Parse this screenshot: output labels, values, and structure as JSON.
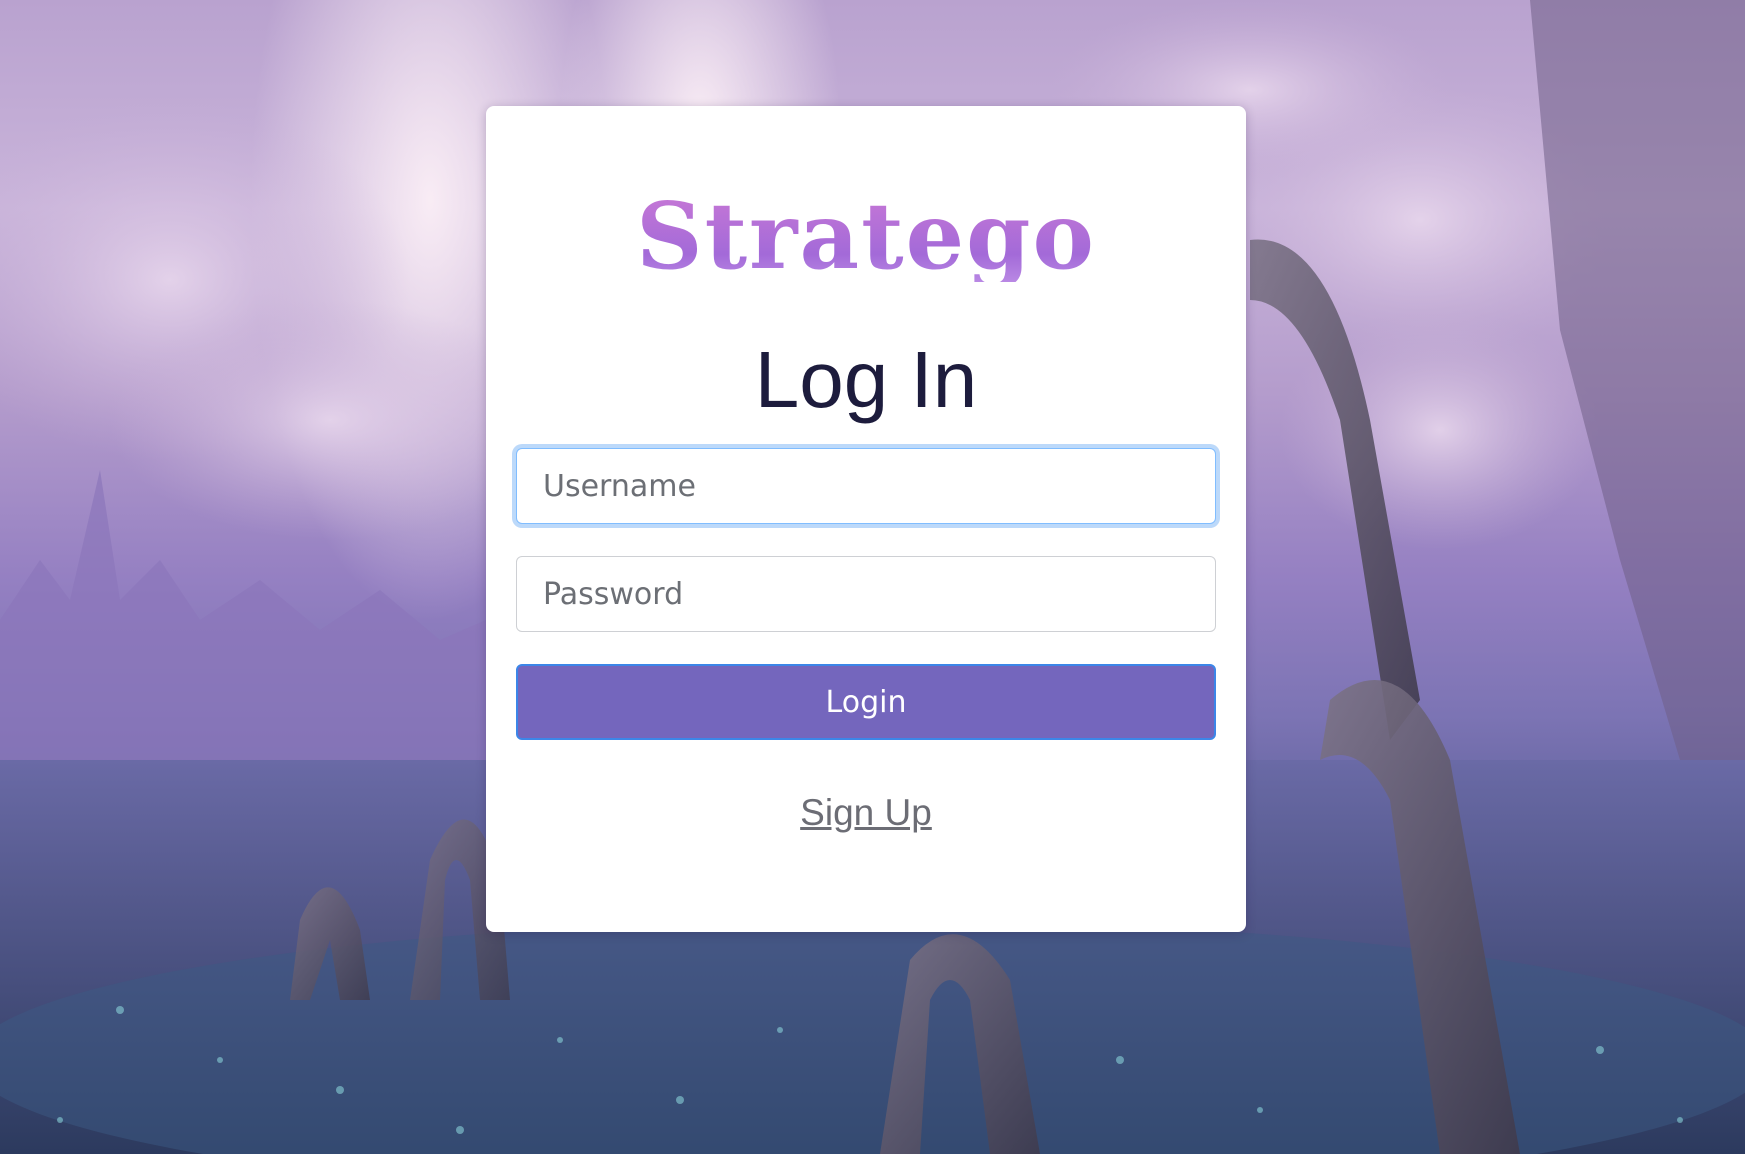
{
  "brand": {
    "name": "Stratego"
  },
  "form": {
    "title": "Log In",
    "username_placeholder": "Username",
    "password_placeholder": "Password",
    "login_label": "Login",
    "signup_label": "Sign Up"
  },
  "colors": {
    "brand_gradient": [
      "#c878d6",
      "#a36ad8"
    ],
    "button": "#7466bd",
    "button_border": "#3c86e8",
    "focus_ring": "#bcd9fa",
    "title": "#1d1c3d",
    "link": "#6c6d75"
  }
}
